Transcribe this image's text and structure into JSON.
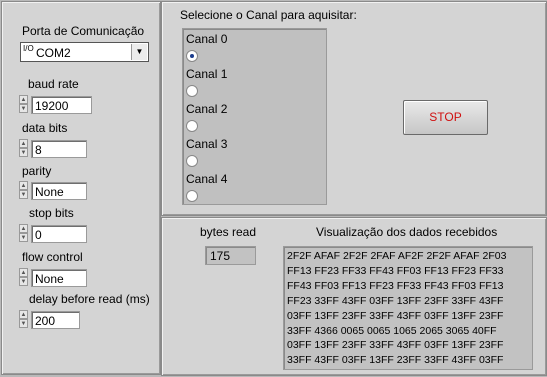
{
  "serial": {
    "port_label": "Porta de Comunicação",
    "port_value": "COM2",
    "io_prefix": "I/O",
    "baud_label": "baud rate",
    "baud_value": "19200",
    "data_bits_label": "data bits",
    "data_bits_value": "8",
    "parity_label": "parity",
    "parity_value": "None",
    "stop_bits_label": "stop bits",
    "stop_bits_value": "0",
    "flow_label": "flow control",
    "flow_value": "None",
    "delay_label": "delay before read (ms)",
    "delay_value": "200"
  },
  "channels": {
    "title": "Selecione o Canal para aquisitar:",
    "items": [
      {
        "label": "Canal 0",
        "selected": true
      },
      {
        "label": "Canal 1",
        "selected": false
      },
      {
        "label": "Canal 2",
        "selected": false
      },
      {
        "label": "Canal 3",
        "selected": false
      },
      {
        "label": "Canal 4",
        "selected": false
      }
    ],
    "stop_label": "STOP",
    "stop_color": "#d01010"
  },
  "readout": {
    "bytes_label": "bytes read",
    "bytes_value": "175",
    "data_title": "Visualização dos dados recebidos",
    "lines": [
      "2F2F AFAF 2F2F 2FAF AF2F 2F2F AFAF 2F03",
      "FF13 FF23 FF33 FF43 FF03 FF13 FF23 FF33",
      "FF43 FF03 FF13 FF23 FF33 FF43 FF03 FF13",
      "FF23 33FF 43FF 03FF 13FF 23FF 33FF 43FF",
      "03FF 13FF 23FF 33FF 43FF 03FF 13FF 23FF",
      "33FF 4366 0065 0065 1065 2065 3065 40FF",
      "03FF 13FF 23FF 33FF 43FF 03FF 13FF 23FF",
      "33FF 43FF 03FF 13FF 23FF 33FF 43FF 03FF"
    ]
  }
}
